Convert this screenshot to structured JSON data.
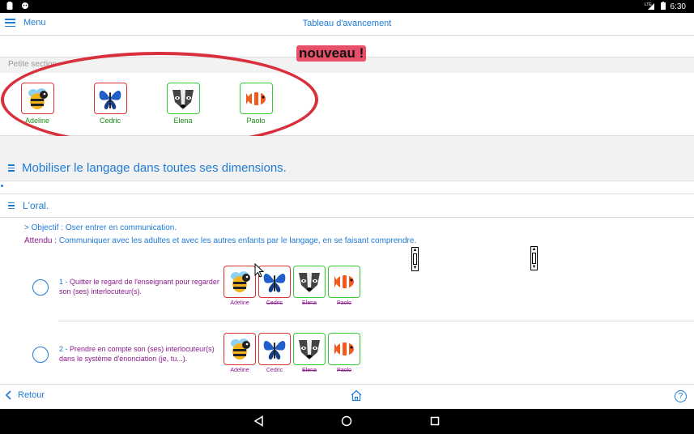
{
  "status": {
    "time": "6:30",
    "network": "LTE"
  },
  "appbar": {
    "menu_label": "Menu",
    "title": "Tableau d'avancement"
  },
  "annotation": {
    "text": "nouveau !"
  },
  "section": {
    "title": "Petite section"
  },
  "kids": [
    {
      "name": "Adeline",
      "icon": "bee-icon",
      "border": "#dd3333"
    },
    {
      "name": "Cedric",
      "icon": "butterfly-icon",
      "border": "#dd3333"
    },
    {
      "name": "Elena",
      "icon": "badger-icon",
      "border": "#33cc33"
    },
    {
      "name": "Paolo",
      "icon": "clownfish-icon",
      "border": "#33cc33"
    }
  ],
  "domain": {
    "title": "Mobiliser le langage dans toutes ses dimensions."
  },
  "subdomain": {
    "title": "L'oral."
  },
  "objectif": {
    "text": "> Objectif : Oser entrer en communication."
  },
  "attendu": {
    "label": "Attendu :",
    "text": "Communiquer avec les adultes et avec les autres enfants par le langage, en se faisant comprendre."
  },
  "items": [
    {
      "num": "1 -",
      "text": "Quitter le regard de l'enseignant pour regarder son (ses) interlocuteur(s).",
      "names": [
        "Adeline",
        "Cedric",
        "Elena",
        "Paolo"
      ],
      "struck": [
        false,
        true,
        true,
        true
      ]
    },
    {
      "num": "2 -",
      "text": "Prendre en compte son (ses) interlocuteur(s) dans le système d'énonciation (je, tu...).",
      "names": [
        "Adeline",
        "Cedric",
        "Elena",
        "Paolo"
      ],
      "struck": [
        false,
        false,
        true,
        true
      ]
    }
  ],
  "bottom": {
    "back_label": "Retour",
    "help_label": "?"
  },
  "colors": {
    "accent": "#1e7bd6",
    "annotation": "#d9303d",
    "purple": "#8a1a8a",
    "green": "#1a8c1a"
  }
}
